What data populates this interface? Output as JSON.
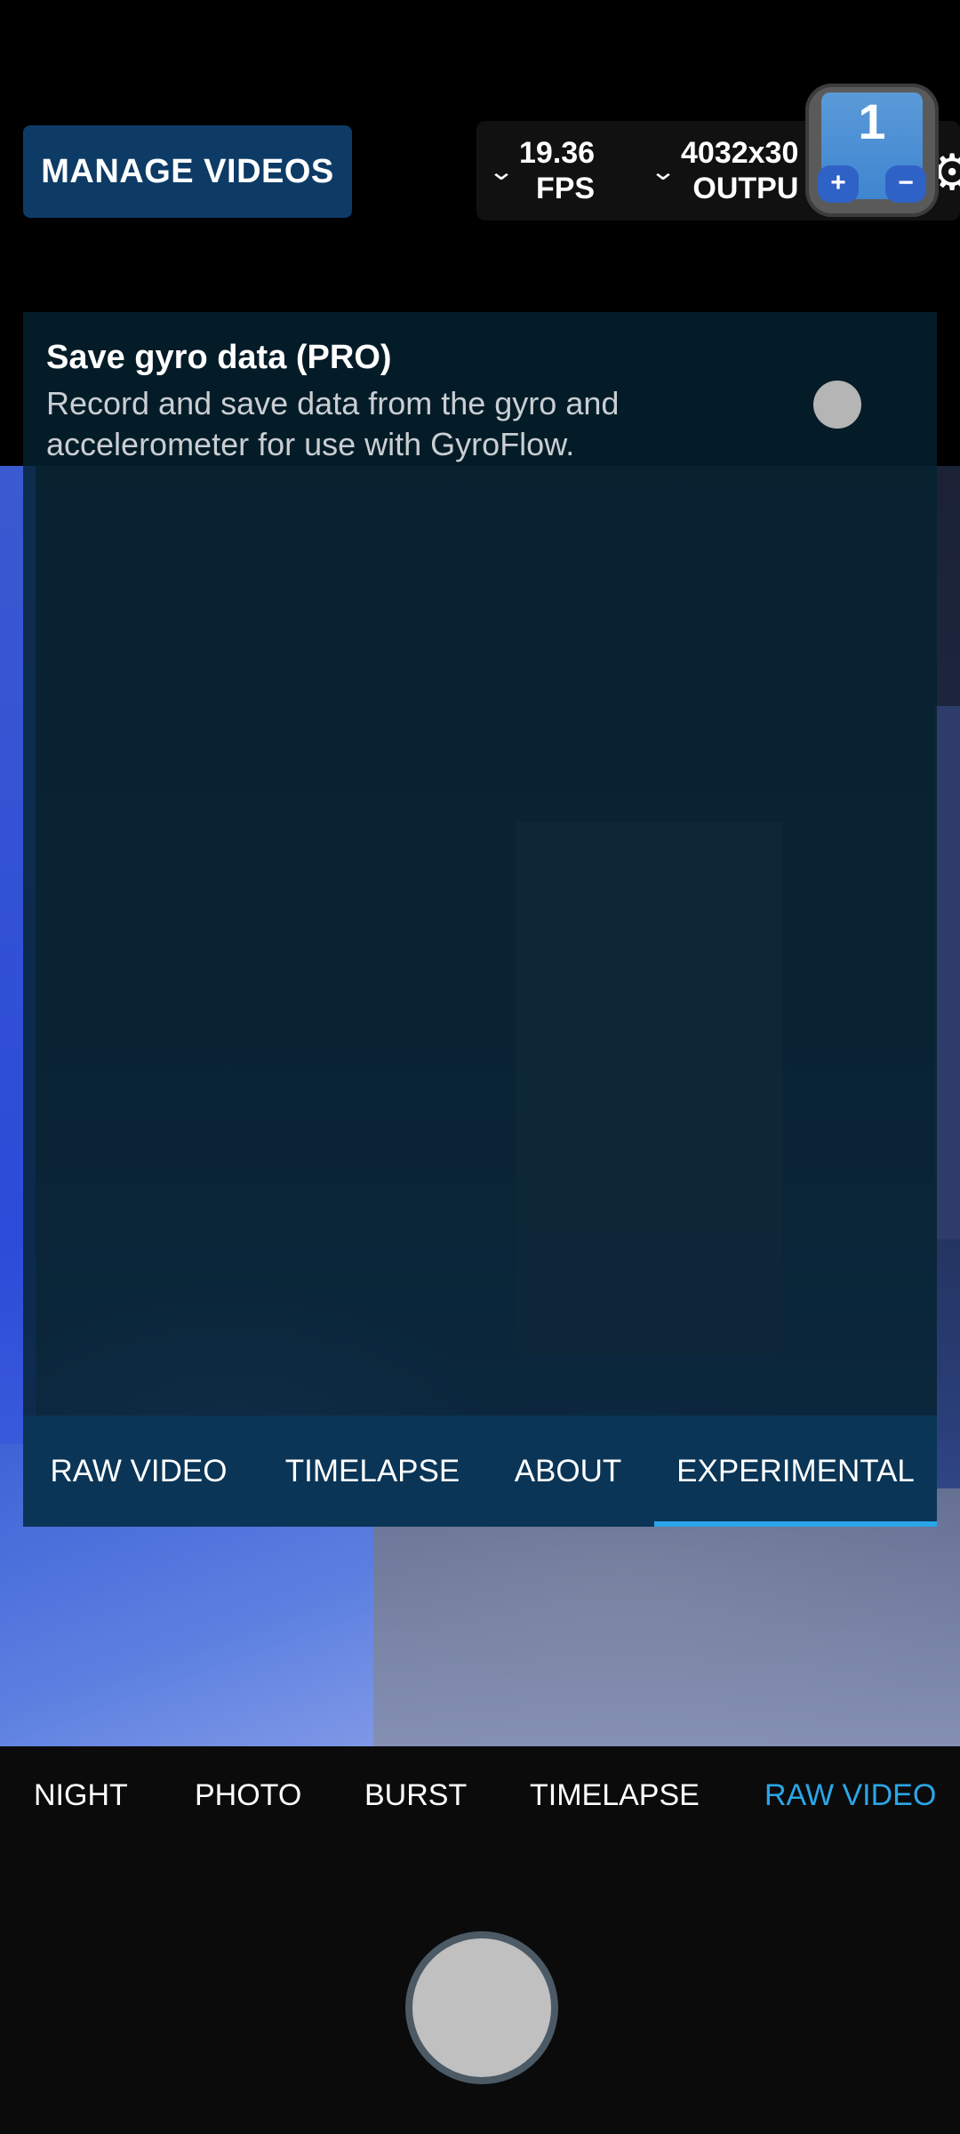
{
  "top_bar": {
    "manage_videos_label": "MANAGE VIDEOS",
    "fps_value": "19.36",
    "fps_label": "FPS",
    "output_value": "4032x30",
    "output_label": "OUTPU",
    "settings_icon": "gear-icon"
  },
  "overlay_counter": {
    "value": "1",
    "plus": "+",
    "minus": "−"
  },
  "settings_panel": {
    "setting": {
      "title": "Save gyro data (PRO)",
      "description": "Record and save data from the gyro and accelerometer for use with GyroFlow.",
      "enabled": false
    },
    "tabs": [
      {
        "label": "RAW VIDEO",
        "active": false
      },
      {
        "label": "TIMELAPSE",
        "active": false
      },
      {
        "label": "ABOUT",
        "active": false
      },
      {
        "label": "EXPERIMENTAL",
        "active": true
      }
    ]
  },
  "camera_modes": [
    {
      "label": "NIGHT",
      "active": false
    },
    {
      "label": "PHOTO",
      "active": false
    },
    {
      "label": "BURST",
      "active": false
    },
    {
      "label": "TIMELAPSE",
      "active": false
    },
    {
      "label": "RAW VIDEO",
      "active": true
    }
  ],
  "colors": {
    "accent": "#2aa6e8",
    "button_bg": "#0d3b66",
    "panel_bg": "#052230",
    "tab_bar_bg": "#0a3556"
  }
}
